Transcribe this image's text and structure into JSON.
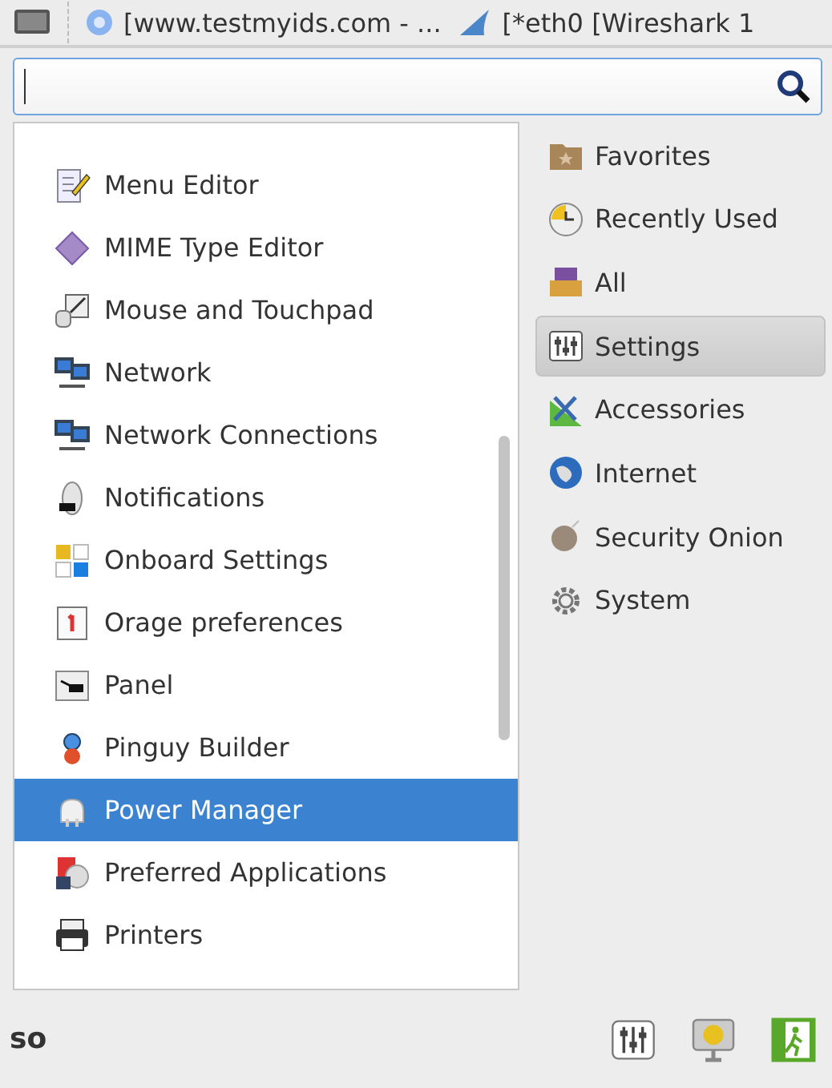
{
  "taskbar": {
    "tasks": [
      {
        "kind": "browser",
        "label": "[www.testmyids.com - ..."
      },
      {
        "kind": "shark",
        "label": "[*eth0   [Wireshark 1"
      }
    ]
  },
  "search": {
    "focused": true
  },
  "apps": [
    {
      "label": "Menu Editor",
      "selected": false
    },
    {
      "label": "MIME Type Editor",
      "selected": false
    },
    {
      "label": "Mouse and Touchpad",
      "selected": false
    },
    {
      "label": "Network",
      "selected": false
    },
    {
      "label": "Network Connections",
      "selected": false
    },
    {
      "label": "Notifications",
      "selected": false
    },
    {
      "label": "Onboard Settings",
      "selected": false
    },
    {
      "label": "Orage preferences",
      "selected": false
    },
    {
      "label": "Panel",
      "selected": false
    },
    {
      "label": "Pinguy Builder",
      "selected": false
    },
    {
      "label": "Power Manager",
      "selected": true
    },
    {
      "label": "Preferred Applications",
      "selected": false
    },
    {
      "label": "Printers",
      "selected": false
    }
  ],
  "categories": [
    {
      "label": "Favorites",
      "selected": false
    },
    {
      "label": "Recently Used",
      "selected": false
    },
    {
      "label": "All",
      "selected": false
    },
    {
      "label": "Settings",
      "selected": true
    },
    {
      "label": "Accessories",
      "selected": false
    },
    {
      "label": "Internet",
      "selected": false
    },
    {
      "label": "Security Onion",
      "selected": false
    },
    {
      "label": "System",
      "selected": false
    }
  ],
  "footer": {
    "user": "so"
  }
}
